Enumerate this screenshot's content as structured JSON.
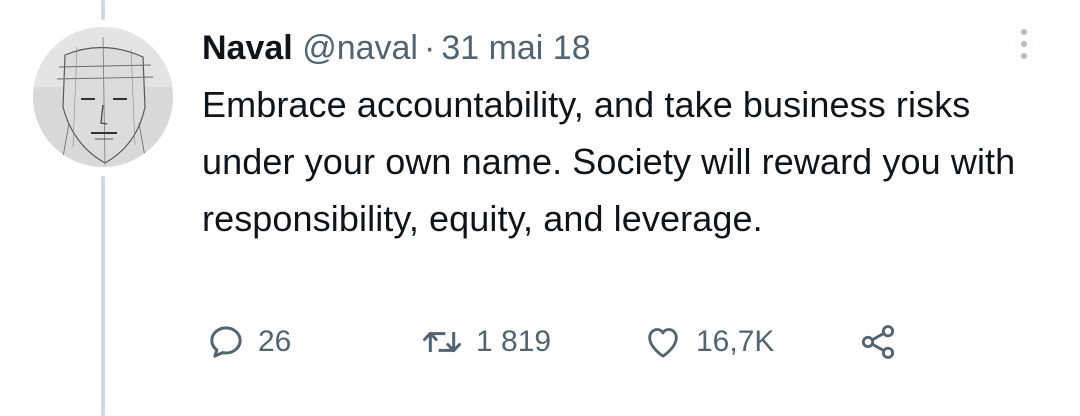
{
  "tweet": {
    "display_name": "Naval",
    "handle": "@naval",
    "separator": "·",
    "date": "31 mai 18",
    "text": "Embrace accountability, and take business risks under your own name. Society will reward you with responsibility, equity, and leverage.",
    "avatar_icon": "sketch-face-avatar"
  },
  "actions": {
    "reply": {
      "icon": "reply-icon",
      "count": "26"
    },
    "retweet": {
      "icon": "retweet-icon",
      "count": "1 819"
    },
    "like": {
      "icon": "heart-icon",
      "count": "16,7K"
    },
    "share": {
      "icon": "share-icon"
    }
  },
  "menu": {
    "icon": "more-options-icon"
  },
  "colors": {
    "text_primary": "#0f1419",
    "text_secondary": "#536471",
    "thread_line": "#cfd9de"
  }
}
